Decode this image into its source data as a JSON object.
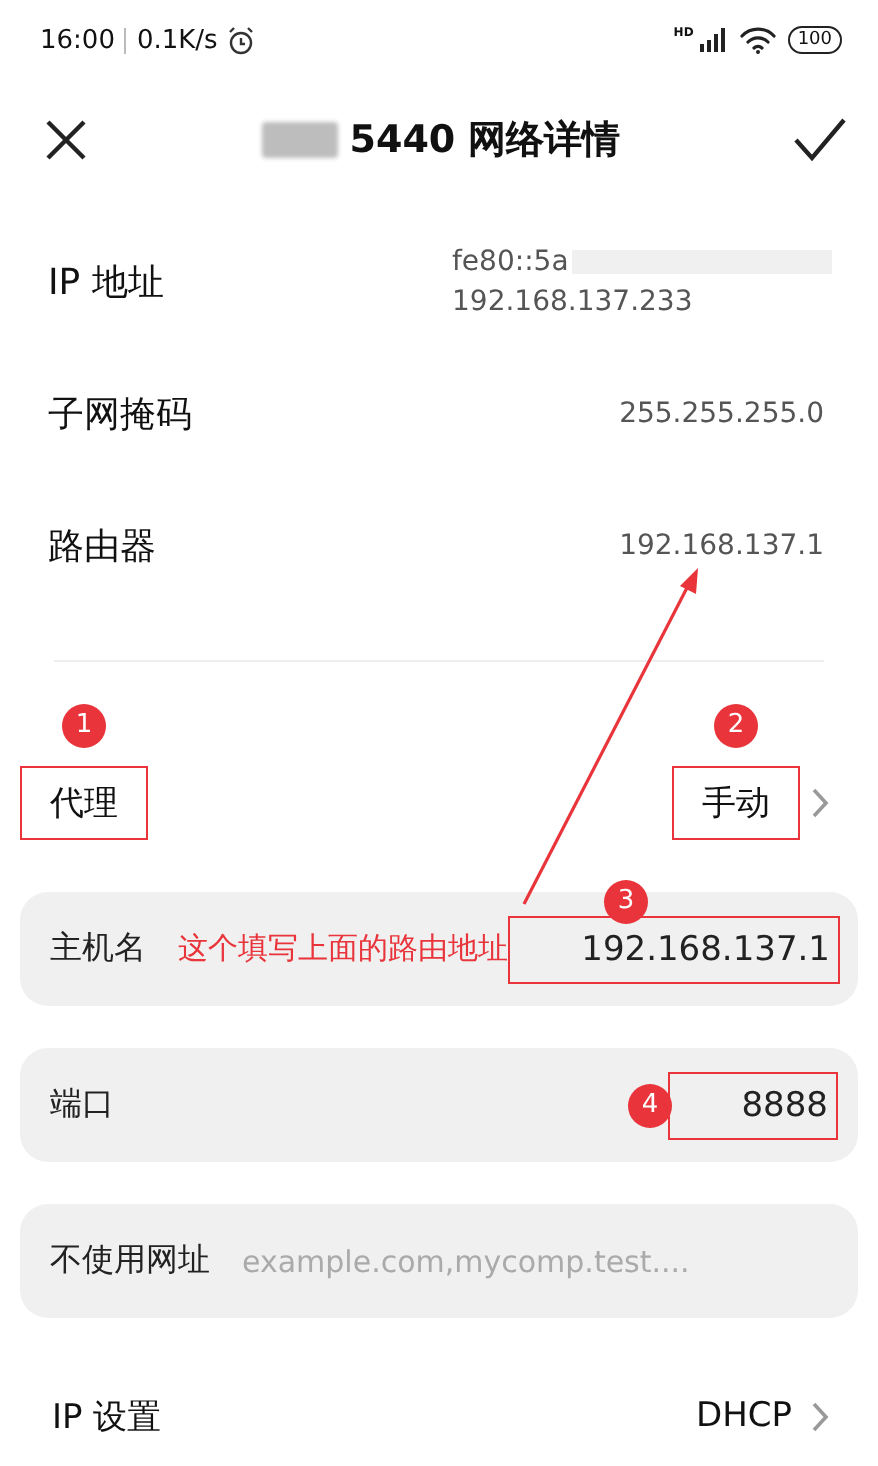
{
  "status_bar": {
    "time": "16:00",
    "speed": "0.1K/s",
    "network_badge": "HD",
    "battery": "100"
  },
  "header": {
    "title": "5440 网络详情",
    "title_redacted": true
  },
  "info_rows": [
    {
      "label": "IP 地址",
      "values": [
        "fe80::5a",
        "192.168.137.233"
      ],
      "redacted": true
    },
    {
      "label": "子网掩码",
      "values": [
        "255.255.255.0"
      ]
    },
    {
      "label": "路由器",
      "values": [
        "192.168.137.1"
      ]
    }
  ],
  "proxy": {
    "label": "代理",
    "value": "手动",
    "label_badge": "1",
    "value_badge": "2"
  },
  "fields": [
    {
      "label": "主机名",
      "value": "192.168.137.1",
      "note": "这个填写上面的路由地址",
      "badge": "3"
    },
    {
      "label": "端口",
      "value": "8888",
      "badge": "4"
    },
    {
      "label": "不使用网址",
      "placeholder": "example.com,mycomp.test...."
    }
  ],
  "ip_settings": {
    "label": "IP 设置",
    "value": "DHCP"
  }
}
